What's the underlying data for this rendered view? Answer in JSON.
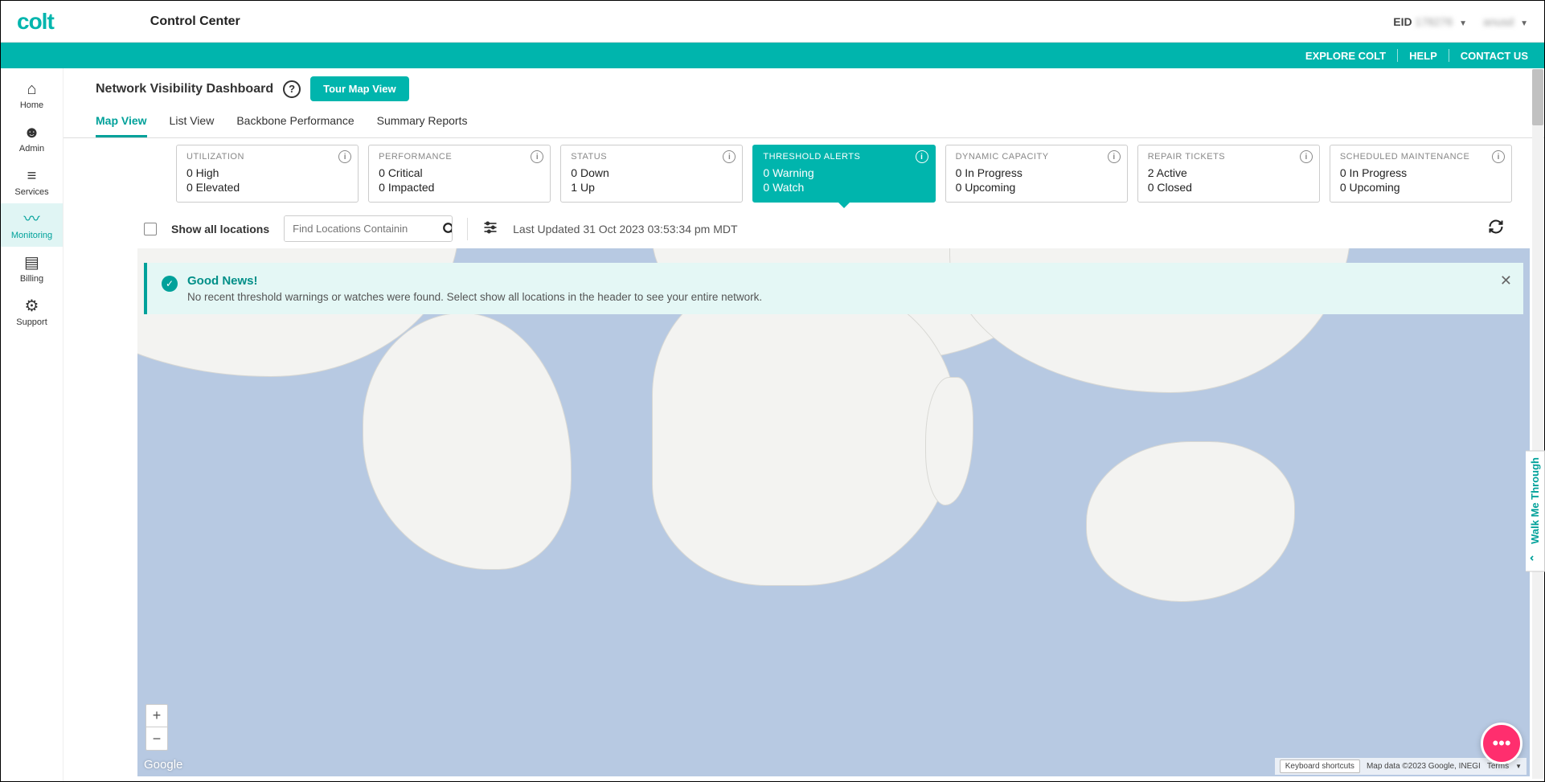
{
  "brand": "colt",
  "app_title": "Control Center",
  "header_right": {
    "eid_label": "EID",
    "eid_value": "178276",
    "user": "anusd"
  },
  "header_links": {
    "explore": "EXPLORE COLT",
    "help": "HELP",
    "contact": "CONTACT US"
  },
  "sidebar": [
    {
      "label": "Home",
      "icon": "⌂"
    },
    {
      "label": "Admin",
      "icon": "☻"
    },
    {
      "label": "Services",
      "icon": "≡"
    },
    {
      "label": "Monitoring",
      "icon": "〰",
      "active": true
    },
    {
      "label": "Billing",
      "icon": "▤"
    },
    {
      "label": "Support",
      "icon": "⚙"
    }
  ],
  "page_title": "Network Visibility Dashboard",
  "tour_button": "Tour Map View",
  "tabs": [
    {
      "label": "Map View",
      "active": true
    },
    {
      "label": "List View"
    },
    {
      "label": "Backbone Performance"
    },
    {
      "label": "Summary Reports"
    }
  ],
  "cards": [
    {
      "title": "UTILIZATION",
      "line1": "0 High",
      "line2": "0 Elevated"
    },
    {
      "title": "PERFORMANCE",
      "line1": "0 Critical",
      "line2": "0 Impacted"
    },
    {
      "title": "STATUS",
      "line1": "0 Down",
      "line2": "1 Up"
    },
    {
      "title": "THRESHOLD ALERTS",
      "line1": "0 Warning",
      "line2": "0 Watch",
      "active": true
    },
    {
      "title": "DYNAMIC CAPACITY",
      "line1": "0 In Progress",
      "line2": "0 Upcoming"
    },
    {
      "title": "REPAIR TICKETS",
      "line1": "2 Active",
      "line2": "0 Closed"
    },
    {
      "title": "SCHEDULED MAINTENANCE",
      "line1": "0 In Progress",
      "line2": "0 Upcoming"
    }
  ],
  "toolbar": {
    "show_all": "Show all locations",
    "search_placeholder": "Find Locations Containin",
    "last_updated": "Last Updated 31 Oct 2023 03:53:34 pm MDT"
  },
  "alert": {
    "title": "Good News!",
    "message": "No recent threshold warnings or watches were found. Select show all locations in the header to see your entire network."
  },
  "map_footer": {
    "shortcuts": "Keyboard shortcuts",
    "data": "Map data ©2023 Google, INEGI",
    "terms": "Terms"
  },
  "google_logo": "Google",
  "walkme": "Walk Me Through",
  "chat_icon": "•••"
}
